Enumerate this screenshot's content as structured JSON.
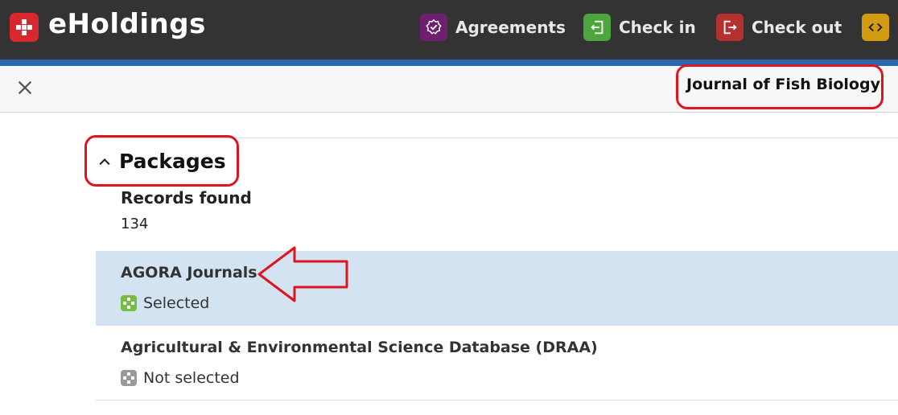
{
  "app": {
    "title": "eHoldings",
    "logo_icon": "eholdings-logo-icon",
    "brand_color": "#d8282d"
  },
  "nav": {
    "items": [
      {
        "label": "Agreements",
        "icon": "agreements-check-icon",
        "color": "#6e1f6d"
      },
      {
        "label": "Check in",
        "icon": "check-in-icon",
        "color": "#4ea53e"
      },
      {
        "label": "Check out",
        "icon": "check-out-icon",
        "color": "#b5312f"
      },
      {
        "label": "",
        "icon": "code-icon",
        "color": "#d29b10"
      }
    ]
  },
  "pane": {
    "title": "Journal of Fish Biology",
    "close_icon": "close-icon"
  },
  "packages": {
    "section_title": "Packages",
    "records_label": "Records found",
    "records_count": "134",
    "rows": [
      {
        "name": "AGORA Journals",
        "status": "Selected",
        "status_color": "#76bd3f",
        "highlighted": true
      },
      {
        "name": "Agricultural & Environmental Science Database (DRAA)",
        "status": "Not selected",
        "status_color": "#9a9a9a",
        "highlighted": false
      }
    ]
  },
  "colors": {
    "topbar": "#333333",
    "accent": "#2b66b0",
    "highlight_row": "#d3e3f1",
    "annotation": "#e0141e"
  }
}
